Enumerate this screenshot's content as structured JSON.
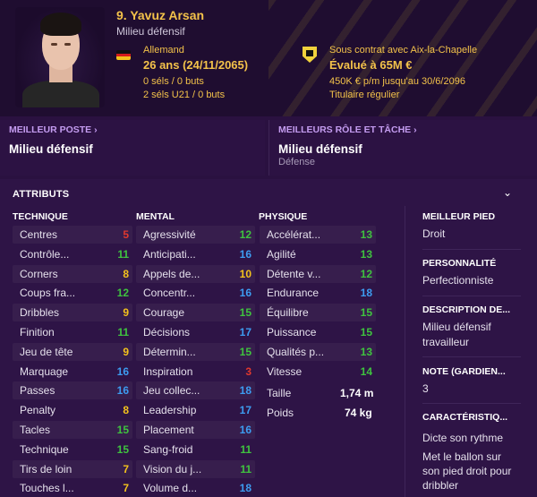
{
  "player": {
    "name": "9. Yavuz Arsan",
    "role": "Milieu défensif",
    "nationality": "Allemand",
    "age": "26 ans (24/11/2065)",
    "caps_senior": "0 séls / 0 buts",
    "caps_u21": "2 séls U21 / 0 buts",
    "contract": "Sous contrat avec Aix-la-Chapelle",
    "value": "Évalué à 65M €",
    "wage": "450K € p/m jusqu'au 30/6/2096",
    "status": "Titulaire régulier"
  },
  "best_position": {
    "title": "MEILLEUR POSTE",
    "value": "Milieu défensif"
  },
  "best_role": {
    "title": "MEILLEURS RÔLE ET TÂCHE",
    "value": "Milieu défensif",
    "sub": "Défense"
  },
  "attributes": {
    "title": "ATTRIBUTS",
    "technique": {
      "header": "TECHNIQUE",
      "items": [
        {
          "label": "Centres",
          "value": "5"
        },
        {
          "label": "Contrôle...",
          "value": "11"
        },
        {
          "label": "Corners",
          "value": "8"
        },
        {
          "label": "Coups fra...",
          "value": "12"
        },
        {
          "label": "Dribbles",
          "value": "9"
        },
        {
          "label": "Finition",
          "value": "11"
        },
        {
          "label": "Jeu de tête",
          "value": "9"
        },
        {
          "label": "Marquage",
          "value": "16"
        },
        {
          "label": "Passes",
          "value": "16"
        },
        {
          "label": "Penalty",
          "value": "8"
        },
        {
          "label": "Tacles",
          "value": "15"
        },
        {
          "label": "Technique",
          "value": "15"
        },
        {
          "label": "Tirs de loin",
          "value": "7"
        },
        {
          "label": "Touches l...",
          "value": "7"
        }
      ]
    },
    "mental": {
      "header": "MENTAL",
      "items": [
        {
          "label": "Agressivité",
          "value": "12"
        },
        {
          "label": "Anticipati...",
          "value": "16"
        },
        {
          "label": "Appels de...",
          "value": "10"
        },
        {
          "label": "Concentr...",
          "value": "16"
        },
        {
          "label": "Courage",
          "value": "15"
        },
        {
          "label": "Décisions",
          "value": "17"
        },
        {
          "label": "Détermin...",
          "value": "15"
        },
        {
          "label": "Inspiration",
          "value": "3"
        },
        {
          "label": "Jeu collec...",
          "value": "18"
        },
        {
          "label": "Leadership",
          "value": "17"
        },
        {
          "label": "Placement",
          "value": "16"
        },
        {
          "label": "Sang-froid",
          "value": "11"
        },
        {
          "label": "Vision du j...",
          "value": "11"
        },
        {
          "label": "Volume d...",
          "value": "18"
        }
      ]
    },
    "physique": {
      "header": "PHYSIQUE",
      "items": [
        {
          "label": "Accélérat...",
          "value": "13"
        },
        {
          "label": "Agilité",
          "value": "13"
        },
        {
          "label": "Détente v...",
          "value": "12"
        },
        {
          "label": "Endurance",
          "value": "18"
        },
        {
          "label": "Équilibre",
          "value": "15"
        },
        {
          "label": "Puissance",
          "value": "15"
        },
        {
          "label": "Qualités p...",
          "value": "13"
        },
        {
          "label": "Vitesse",
          "value": "14"
        }
      ],
      "height_label": "Taille",
      "height_value": "1,74 m",
      "weight_label": "Poids",
      "weight_value": "74 kg"
    }
  },
  "side": {
    "foot_title": "MEILLEUR PIED",
    "foot_value": "Droit",
    "personality_title": "PERSONNALITÉ",
    "personality_value": "Perfectionniste",
    "description_title": "DESCRIPTION DE...",
    "description_value_1": "Milieu défensif",
    "description_value_2": "travailleur",
    "rating_title": "NOTE (GARDIEN...",
    "rating_value": "3",
    "traits_title": "CARACTÉRISTIQ...",
    "trait_1": "Dicte son rythme",
    "trait_2_line1": "Met le ballon sur",
    "trait_2_line2": "son pied droit pour",
    "trait_2_line3": "dribbler"
  },
  "colors": {
    "low": "#e0382e",
    "mid": "#f3c21c",
    "good": "#3fc33f",
    "high": "#3d9cf0",
    "accent": "#c49cf0",
    "gold": "#f3c24a"
  },
  "icons": [
    "chevron-right-icon",
    "chevron-down-icon",
    "germany-flag-icon",
    "club-crest-icon"
  ]
}
